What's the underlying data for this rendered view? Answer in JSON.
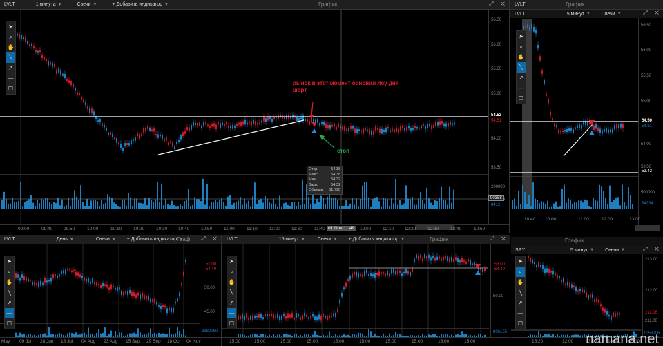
{
  "colors": {
    "up": "#1e7fc0",
    "down": "#c81e2b",
    "line": "#ffffff",
    "annot_red": "#e0202c",
    "annot_green": "#2aa84a",
    "active_tool": "#0e6aa8"
  },
  "tool_icons": [
    "cursor-icon",
    "zoom-icon",
    "hand-icon",
    "trendline-icon",
    "arrow-icon",
    "horizontal-line-icon",
    "rectangle-icon"
  ],
  "main": {
    "symbol": "LVLT",
    "interval": "1 минута",
    "style": "Свечи",
    "add_indicator": "+ Добавить индикатор",
    "title": "График",
    "y_labels": [
      "56.50",
      "56.00",
      "55.50",
      "55.00",
      "54.50",
      "54.00",
      "53.50"
    ],
    "vol_labels": [
      "200000",
      "100000"
    ],
    "price_tag": "54.52",
    "price_tag2": "54.51",
    "vol_tag": "90358",
    "vol_tag2": "8412",
    "x_labels": [
      "09:00",
      "09:40",
      "09:50",
      "10:00",
      "10:10",
      "10:20",
      "10:30",
      "10:40",
      "10:50",
      "11:00",
      "11:10",
      "11:20",
      "11:30",
      "11:40",
      "12:00",
      "12:10",
      "12:20",
      "12:30",
      "12:40",
      "12:50"
    ],
    "cursor_time": "01 Nov 11:49",
    "annotation": "рынок в этот момент обновил лоу дня шорт",
    "stop_label": "стоп",
    "tooltip": [
      [
        "Откр.",
        "54.38"
      ],
      [
        "Макс.",
        "54.38"
      ],
      [
        "Мин.",
        "54.32"
      ],
      [
        "Закр.",
        "54.32"
      ],
      [
        "Объемы",
        "11,790"
      ]
    ]
  },
  "right_top": {
    "symbol": "LVLT",
    "interval": "5 минут",
    "style": "Свечи",
    "title": "График",
    "y_labels": [
      "56.50",
      "56.00",
      "55.50",
      "55.00",
      "54.50",
      "54.00",
      "53.50"
    ],
    "price_tag": "54.50",
    "price_tag2": "54.61",
    "level_low": "53.42",
    "vol_labels": [
      "500000"
    ],
    "vol_tag": "84234",
    "x_labels": [
      "18:40",
      "10:00",
      "11:00",
      "12:00",
      "13:00"
    ]
  },
  "bottom_left": {
    "symbol": "LVLT",
    "interval": "День",
    "style": "Свечи",
    "add_indicator": "+ Добавить индикатор",
    "title": "Граф",
    "y_labels": [
      "55.00",
      "50.00",
      "45.00"
    ],
    "price_tag": "51.00",
    "price_tag2": "54.49",
    "vol_tag": "3180060",
    "x_labels": [
      "May",
      "09 Jun",
      "28 Jun",
      "18 Jul",
      "04 Aug",
      "23 Aug",
      "15 Sep",
      "29 Sep",
      "18 Oct",
      "04 Nov"
    ]
  },
  "bottom_mid": {
    "symbol": "LVLT",
    "interval": "15 минут",
    "style": "Свечи",
    "add_indicator": "+ Добавить индикатор",
    "title": "График",
    "y_labels": [
      "55.00",
      "50.00"
    ],
    "price_tag": "53.00",
    "price_tag2": "54.49",
    "vol_tag": "806155",
    "x_labels": [
      "15:00",
      "15:00",
      "15:00",
      "15:00",
      "15:00",
      "15:00",
      "15:00",
      "15:00",
      "15:00",
      "15:00"
    ]
  },
  "bottom_right": {
    "symbol": "SPY",
    "interval": "5 минут",
    "style": "Свечи",
    "title": "График",
    "y_labels": [
      "213.00",
      "212.00",
      "211.00"
    ],
    "price_tag": "211.06",
    "price_tag2": "211.00",
    "vol_tag": "1053706",
    "x_labels": [
      "15:20",
      "12:00",
      "13:00",
      "14:00",
      "15:00"
    ]
  },
  "watermark": "namana.net",
  "window_controls": "⤢ ✕"
}
